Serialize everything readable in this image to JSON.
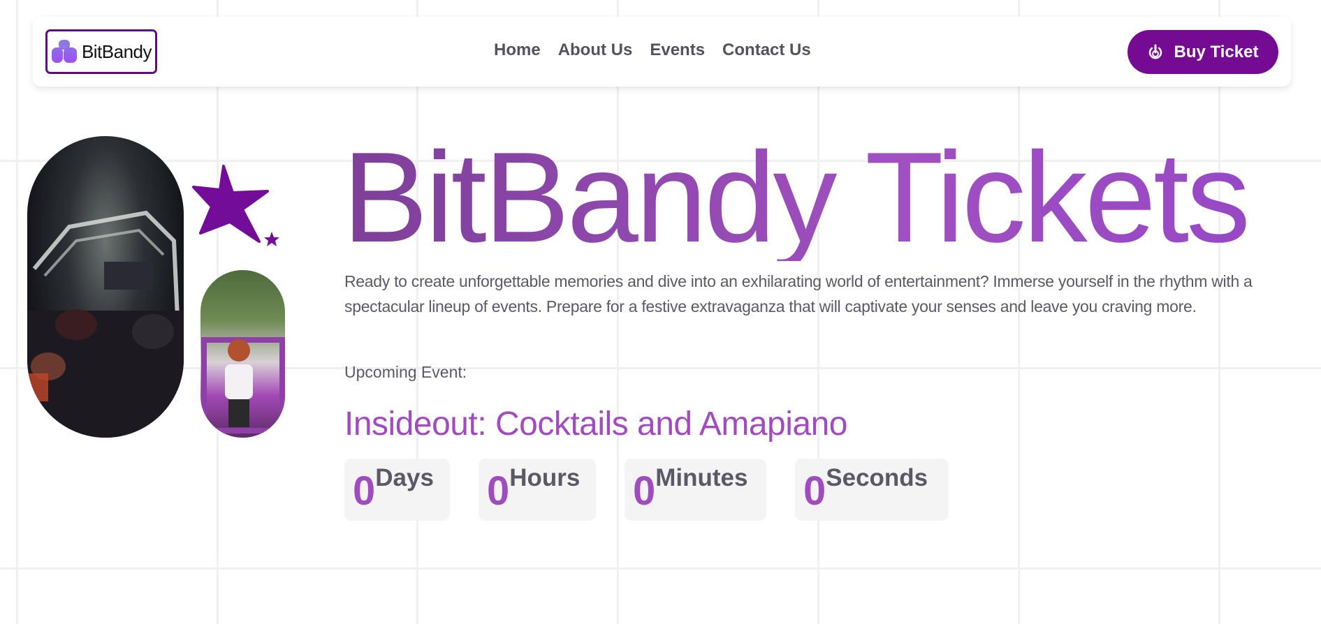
{
  "brand": {
    "name": "BitBandy",
    "accent": "#750b92"
  },
  "nav": {
    "links": [
      {
        "label": "Home"
      },
      {
        "label": "About Us"
      },
      {
        "label": "Events"
      },
      {
        "label": "Contact Us"
      }
    ],
    "buy_button": {
      "label": "Buy Ticket",
      "icon": "power-icon"
    }
  },
  "hero": {
    "title": "BitBandy Tickets",
    "description": "Ready to create unforgettable memories and dive into an exhilarating world of entertainment? Immerse yourself in the rhythm with a spectacular lineup of events. Prepare for a festive extravaganza that will captivate your senses and leave you craving more.",
    "upcoming_label": "Upcoming Event:",
    "event_name": "Insideout: Cocktails and Amapiano",
    "countdown": [
      {
        "value": "0",
        "unit": "Days"
      },
      {
        "value": "0",
        "unit": "Hours"
      },
      {
        "value": "0",
        "unit": "Minutes"
      },
      {
        "value": "0",
        "unit": "Seconds"
      }
    ]
  }
}
